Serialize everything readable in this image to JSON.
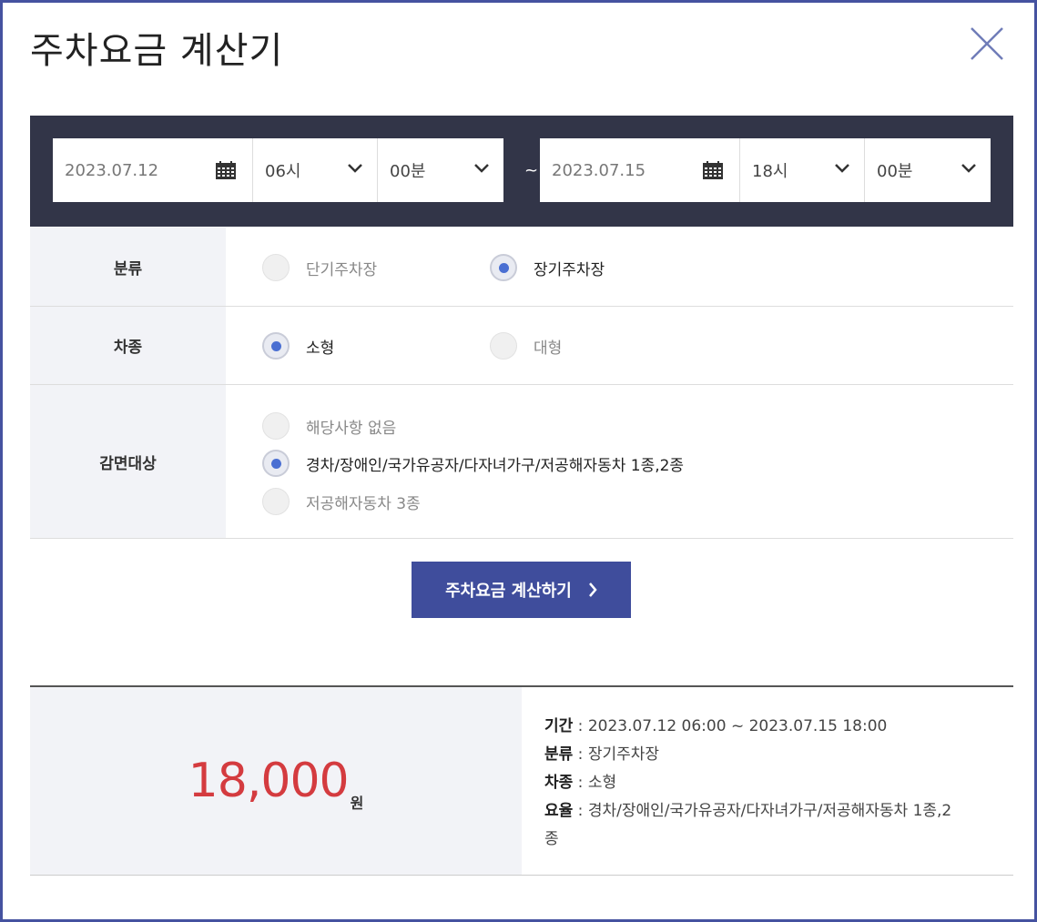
{
  "title": "주차요금 계산기",
  "date_range": {
    "start": {
      "date": "2023.07.12",
      "hour": "06시",
      "minute": "00분"
    },
    "separator": "~",
    "end": {
      "date": "2023.07.15",
      "hour": "18시",
      "minute": "00분"
    }
  },
  "category": {
    "label": "분류",
    "options": [
      {
        "label": "단기주차장",
        "selected": false
      },
      {
        "label": "장기주차장",
        "selected": true
      }
    ]
  },
  "vehicle": {
    "label": "차종",
    "options": [
      {
        "label": "소형",
        "selected": true
      },
      {
        "label": "대형",
        "selected": false
      }
    ]
  },
  "discount": {
    "label": "감면대상",
    "options": [
      {
        "label": "해당사항 없음",
        "selected": false
      },
      {
        "label": "경차/장애인/국가유공자/다자녀가구/저공해자동차 1종,2종",
        "selected": true
      },
      {
        "label": "저공해자동차 3종",
        "selected": false
      }
    ]
  },
  "calculate_button": "주차요금 계산하기",
  "result": {
    "amount": "18,000",
    "unit": "원",
    "period_key": "기간",
    "period_value": " : 2023.07.12 06:00 ~ 2023.07.15 18:00",
    "category_key": "분류",
    "category_value": " : 장기주차장",
    "vehicle_key": "차종",
    "vehicle_value": " : 소형",
    "rate_key": "요율",
    "rate_value_line1": " : 경차/장애인/국가유공자/다자녀가구/저공해자동차 1종,2",
    "rate_value_line2": "종"
  },
  "colors": {
    "accent": "#3f4d9c",
    "dark_bar": "#323548",
    "amount": "#d43b3f",
    "border": "#4552a0",
    "radio_dot": "#4a6fd2"
  }
}
